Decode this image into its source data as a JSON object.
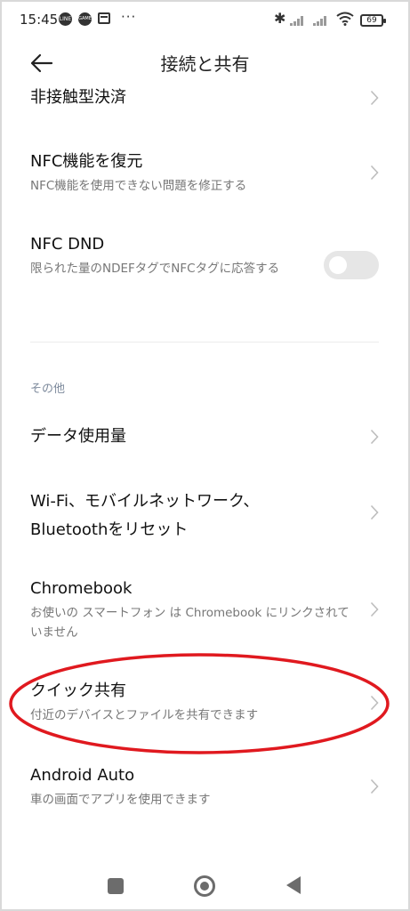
{
  "status_bar": {
    "time": "15:45",
    "line_label": "LINE",
    "circle_label": "GAME",
    "more": "···",
    "battery": "69"
  },
  "header": {
    "title": "接続と共有"
  },
  "rows": {
    "contactless": {
      "title": "非接触型決済"
    },
    "nfc_restore": {
      "title": "NFC機能を復元",
      "subtitle": "NFC機能を使用できない問題を修正する"
    },
    "nfc_dnd": {
      "title": "NFC DND",
      "subtitle": "限られた量のNDEFタグでNFCタグに応答する",
      "toggle_on": false
    },
    "data_usage": {
      "title": "データ使用量"
    },
    "reset": {
      "title": "Wi-Fi、モバイルネットワーク、Bluetoothをリセット"
    },
    "chromebook": {
      "title": "Chromebook",
      "subtitle": "お使いの スマートフォン は Chromebook にリンクされていません"
    },
    "quick_share": {
      "title": "クイック共有",
      "subtitle": "付近のデバイスとファイルを共有できます"
    },
    "android_auto": {
      "title": "Android Auto",
      "subtitle": "車の画面でアプリを使用できます"
    }
  },
  "section": {
    "other": "その他"
  },
  "colors": {
    "highlight": "#e0191f",
    "section_text": "#7d8a9c"
  }
}
